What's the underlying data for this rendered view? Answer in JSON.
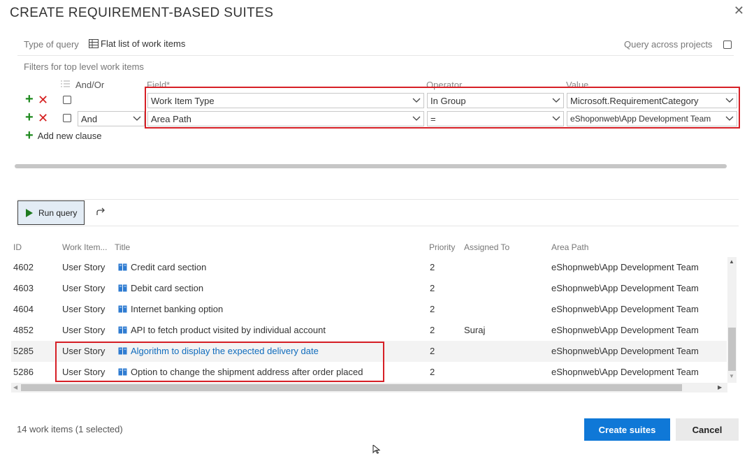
{
  "dialog": {
    "title": "CREATE REQUIREMENT-BASED SUITES",
    "close_glyph": "✕"
  },
  "query": {
    "type_label": "Type of query",
    "type_value": "Flat list of work items",
    "across_projects_label": "Query across projects",
    "filters_label": "Filters for top level work items",
    "headers": {
      "and_or": "And/Or",
      "field": "Field*",
      "operator": "Operator",
      "value": "Value"
    },
    "clauses": [
      {
        "and_or": "",
        "field": "Work Item Type",
        "operator": "In Group",
        "value": "Microsoft.RequirementCategory"
      },
      {
        "and_or": "And",
        "field": "Area Path",
        "operator": "=",
        "value": "eShoponweb\\App Development Team"
      }
    ],
    "add_clause_label": "Add new clause",
    "plus_glyph": "+",
    "remove_glyph": "✕"
  },
  "toolbar": {
    "run_query_label": "Run query"
  },
  "grid": {
    "columns": [
      "ID",
      "Work Item...",
      "Title",
      "Priority",
      "Assigned To",
      "Area Path"
    ],
    "rows": [
      {
        "id": "4602",
        "type": "User Story",
        "title": "Credit card section",
        "priority": "2",
        "assigned": "",
        "area": "eShopnweb\\App Development Team"
      },
      {
        "id": "4603",
        "type": "User Story",
        "title": "Debit card section",
        "priority": "2",
        "assigned": "",
        "area": "eShopnweb\\App Development Team"
      },
      {
        "id": "4604",
        "type": "User Story",
        "title": "Internet banking option",
        "priority": "2",
        "assigned": "",
        "area": "eShopnweb\\App Development Team"
      },
      {
        "id": "4852",
        "type": "User Story",
        "title": "API to fetch product visited by individual account",
        "priority": "2",
        "assigned": "Suraj",
        "area": "eShopnweb\\App Development Team"
      },
      {
        "id": "5285",
        "type": "User Story",
        "title": "Algorithm to display the expected delivery date",
        "priority": "2",
        "assigned": "",
        "area": "eShopnweb\\App Development Team"
      },
      {
        "id": "5286",
        "type": "User Story",
        "title": "Option to change the shipment address after order placed",
        "priority": "2",
        "assigned": "",
        "area": "eShopnweb\\App Development Team"
      }
    ],
    "selected_row_id": "5285",
    "scroll_up_glyph": "▲",
    "scroll_down_glyph": "▼",
    "scroll_left_glyph": "◀",
    "scroll_right_glyph": "▶"
  },
  "footer": {
    "count_text": "14 work items (1 selected)",
    "create_label": "Create suites",
    "cancel_label": "Cancel"
  },
  "colors": {
    "primary": "#0f78d7",
    "link": "#0f6cbd",
    "highlight_border": "#d61f26",
    "add_green": "#1f8a1f",
    "remove_red": "#d51d1d"
  },
  "icons": {
    "query_type": "table-icon",
    "run": "play-icon",
    "redo": "redo-icon",
    "work_item": "book-icon",
    "filter_group": "group-clauses-icon"
  }
}
